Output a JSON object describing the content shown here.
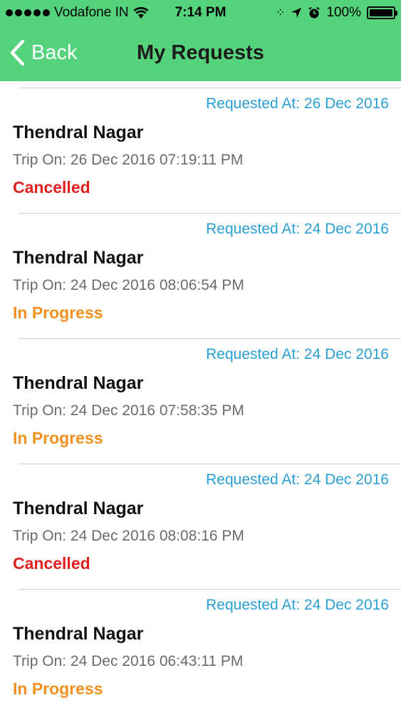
{
  "status_bar": {
    "carrier": "Vodafone IN",
    "time": "7:14 PM",
    "battery": "100%",
    "icons": [
      "wifi-icon",
      "activity-icon",
      "location-arrow-icon",
      "alarm-icon",
      "battery-icon"
    ]
  },
  "nav": {
    "back_label": "Back",
    "title": "My Requests"
  },
  "colors": {
    "header": "#54d37c",
    "requested": "#2a9fd6",
    "cancelled": "#e0201e",
    "in_progress": "#f0901e"
  },
  "requests": [
    {
      "requested_at": "Requested At: 26 Dec 2016",
      "place": "Thendral Nagar",
      "trip_on": "Trip On: 26 Dec 2016 07:19:11 PM",
      "status": "Cancelled",
      "status_color": "#e0201e"
    },
    {
      "requested_at": "Requested At: 24 Dec 2016",
      "place": "Thendral Nagar",
      "trip_on": "Trip On: 24 Dec 2016 08:06:54 PM",
      "status": "In Progress",
      "status_color": "#f0901e"
    },
    {
      "requested_at": "Requested At: 24 Dec 2016",
      "place": "Thendral Nagar",
      "trip_on": "Trip On: 24 Dec 2016 07:58:35 PM",
      "status": "In Progress",
      "status_color": "#f0901e"
    },
    {
      "requested_at": "Requested At: 24 Dec 2016",
      "place": "Thendral Nagar",
      "trip_on": "Trip On: 24 Dec 2016 08:08:16 PM",
      "status": "Cancelled",
      "status_color": "#e0201e"
    },
    {
      "requested_at": "Requested At: 24 Dec 2016",
      "place": "Thendral Nagar",
      "trip_on": "Trip On: 24 Dec 2016 06:43:11 PM",
      "status": "In Progress",
      "status_color": "#f0901e"
    }
  ]
}
